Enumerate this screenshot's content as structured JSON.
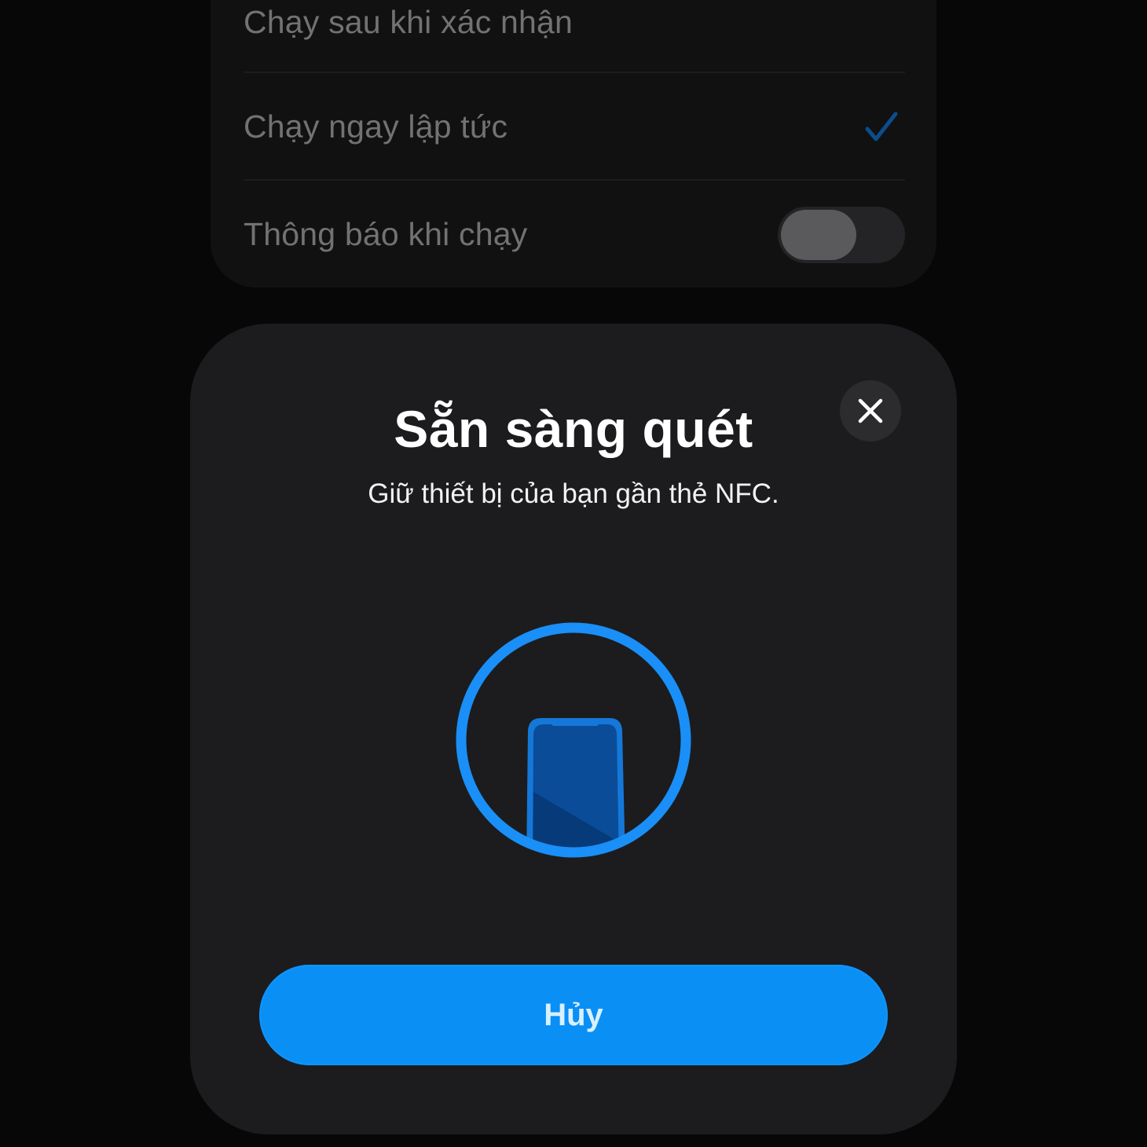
{
  "settings": {
    "rows": [
      {
        "label": "Chạy sau khi xác nhận"
      },
      {
        "label": "Chạy ngay lập tức",
        "selected": true
      },
      {
        "label": "Thông báo khi chạy",
        "toggle_on": false
      }
    ]
  },
  "nfc_sheet": {
    "title": "Sẵn sàng quét",
    "subtitle": "Giữ thiết bị của bạn gần thẻ NFC.",
    "close_icon": "close-icon",
    "illustration_icon": "phone-in-circle-icon",
    "cancel_label": "Hủy"
  },
  "colors": {
    "accent": "#0a8ff5",
    "sheet_background": "#1c1c1e",
    "ring": "#1a8ff7",
    "phone_body": "#0a4f9a"
  }
}
